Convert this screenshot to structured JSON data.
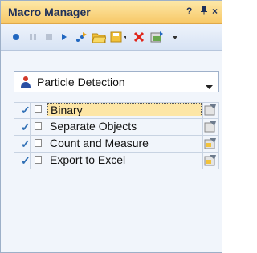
{
  "window": {
    "title": "Macro Manager",
    "pin_label": "?  \b",
    "help_glyph": "?",
    "pin_glyph": "↑",
    "close_glyph": "×"
  },
  "toolbar": {
    "icons": [
      "record-icon",
      "pause-icon",
      "stop-icon",
      "play-icon",
      "run-step-icon",
      "open-folder-icon",
      "save-dropdown-icon",
      "delete-icon",
      "export-icon"
    ]
  },
  "combo": {
    "selected": "Particle Detection",
    "icon": "macro-icon"
  },
  "macros": [
    {
      "name": "Binary",
      "enabled": true,
      "selected": true
    },
    {
      "name": "Separate Objects",
      "enabled": true,
      "selected": false
    },
    {
      "name": "Count and Measure",
      "enabled": true,
      "selected": false
    },
    {
      "name": "Export to Excel",
      "enabled": true,
      "selected": false
    }
  ],
  "colors": {
    "accent": "#f7c867",
    "check": "#2f6fb5",
    "selection": "#fde6a6"
  }
}
